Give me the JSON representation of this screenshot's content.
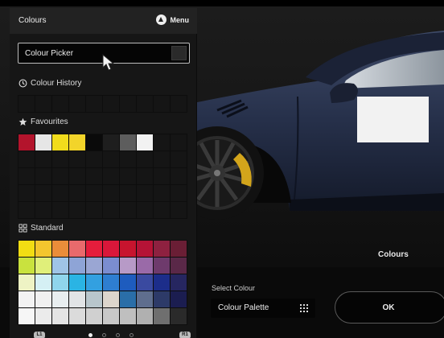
{
  "panel": {
    "title": "Colours",
    "menu_label": "Menu",
    "picker_label": "Colour Picker",
    "history_title": "Colour History",
    "favourites_title": "Favourites",
    "standard_title": "Standard",
    "l1_label": "L1",
    "r1_label": "R1",
    "page_count": 4,
    "active_page": 0
  },
  "favourites": [
    "#b3142c",
    "#e6e6e6",
    "#f1dc1c",
    "#f2d42a",
    "#0a0a0a",
    "#1e1e1e",
    "#5d5d5d",
    "#f2f2f2"
  ],
  "standard": [
    [
      "#f2dd13",
      "#f3c62e",
      "#ea8d3a",
      "#e96a6c",
      "#e51d3c",
      "#d9173a",
      "#c7142e",
      "#b51336",
      "#8e2140",
      "#6a1e35"
    ],
    [
      "#c9e23e",
      "#e0ef7a",
      "#9fc4e6",
      "#8ea4d6",
      "#9aa6d3",
      "#7b8dd0",
      "#b79ac7",
      "#9a6aa8",
      "#6e3a6c",
      "#5a2848"
    ],
    [
      "#eef3c4",
      "#d5f0f4",
      "#8fd5ec",
      "#2ab4e4",
      "#33a0e0",
      "#2e7ed0",
      "#1e5cbe",
      "#3a4aa0",
      "#1c2d8a",
      "#262660"
    ],
    [
      "#f3f3f3",
      "#f0f0f0",
      "#e8eef0",
      "#e1e4e6",
      "#b8c6cc",
      "#dcd5cc",
      "#2a6ea8",
      "#5f6e8e",
      "#2d3a68",
      "#1b1d50"
    ],
    [
      "#f6f6f6",
      "#ebebeb",
      "#e4e4e4",
      "#dbdbdb",
      "#d0d0d0",
      "#c8c8c8",
      "#bfbfbf",
      "#b0b0b0",
      "#6f6f6f",
      "#2a2a2a"
    ]
  ],
  "scene": {
    "colours_label": "Colours",
    "select_colour_label": "Select Colour",
    "palette_label": "Colour Palette",
    "ok_label": "OK"
  }
}
